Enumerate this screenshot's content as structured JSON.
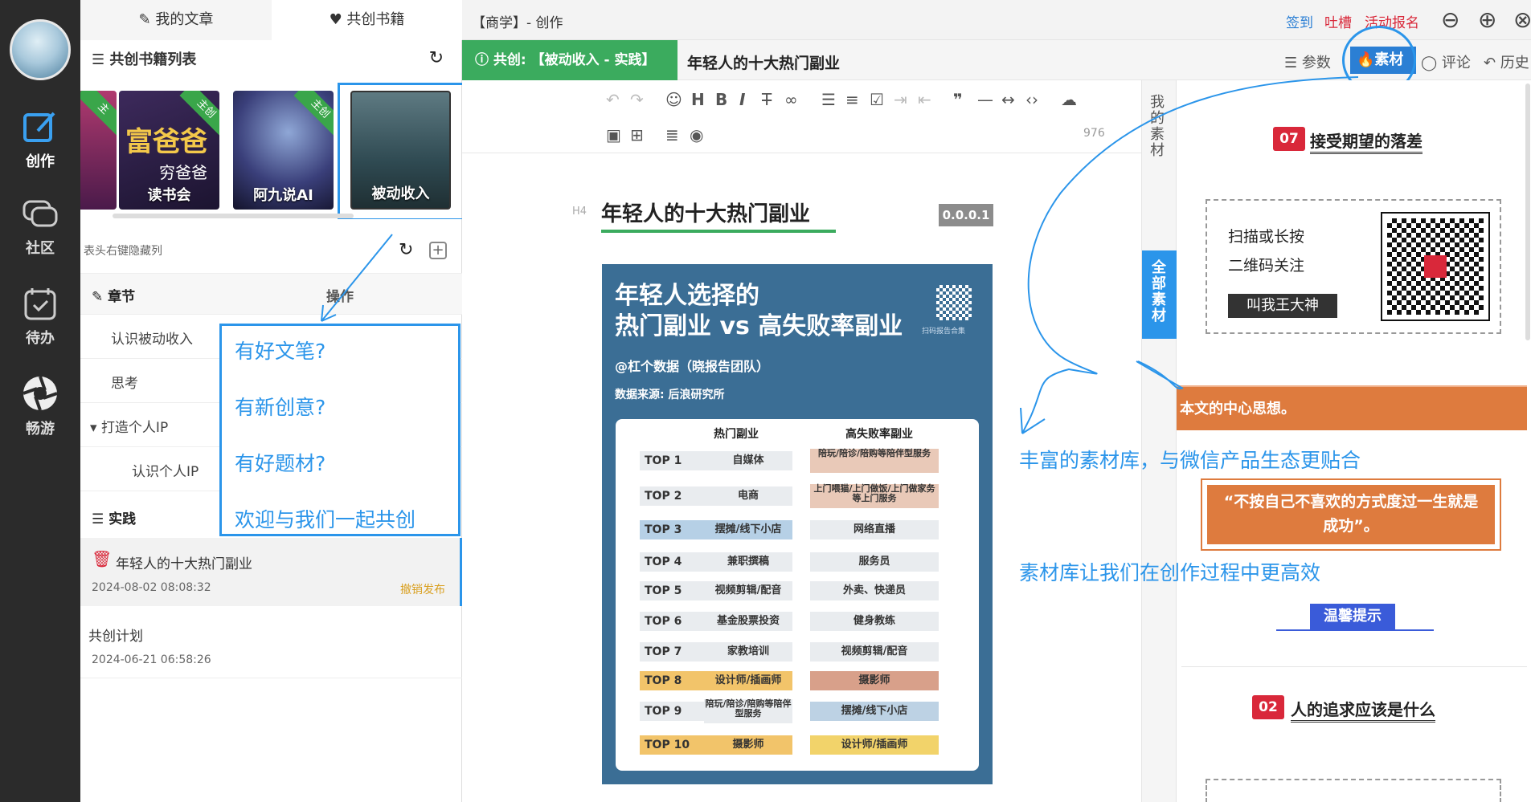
{
  "rail": {
    "items": [
      {
        "label": "创作"
      },
      {
        "label": "社区"
      },
      {
        "label": "待办"
      },
      {
        "label": "畅游"
      }
    ]
  },
  "left_panel": {
    "tabs": [
      "我的文章",
      "共创书籍"
    ],
    "section_title": "共创书籍列表",
    "books": [
      {
        "title": "穷爸爸",
        "subtitle": "读书会",
        "ribbon": "主创",
        "cover_text": "富爸爸"
      },
      {
        "title": "阿九说AI",
        "ribbon": "主创"
      },
      {
        "title": "被动收入"
      }
    ],
    "table_hint": "表头右键隐藏列",
    "columns": [
      "章节",
      "操作"
    ],
    "chapters": [
      "认识被动收入",
      "思考",
      "打造个人IP",
      "认识个人IP"
    ],
    "practice_label": "实践",
    "articles": [
      {
        "title": "年轻人的十大热门副业",
        "date": "2024-08-02 08:08:32",
        "action": "撤销发布"
      },
      {
        "title": "共创计划",
        "date": "2024-06-21 06:58:26"
      }
    ],
    "hints": [
      "有好文笔?",
      "有新创意?",
      "有好题材?",
      "欢迎与我们一起共创"
    ]
  },
  "top_bar": {
    "title": "【商学】- 创作",
    "links": [
      "签到",
      "吐槽",
      "活动报名"
    ]
  },
  "editor": {
    "green_tag": "共创: 【被动收入 - 实践】",
    "doc_title": "年轻人的十大热门副业",
    "char_count": "976",
    "heading_tag": "H4",
    "heading": "年轻人的十大热门副业",
    "version": "0.0.0.1",
    "infographic": {
      "title_line1": "年轻人选择的",
      "title_line2": "热门副业 vs 高失败率副业",
      "author": "@杠个数据（晓报告团队）",
      "source": "数据来源: 后浪研究所",
      "qr_caption": "扫码报告合集",
      "col_left": "热门副业",
      "col_right": "高失败率副业",
      "rows": [
        {
          "rank": "TOP 1",
          "left": "自媒体",
          "right": "陪玩/陪诊/陪购等陪伴型服务"
        },
        {
          "rank": "TOP 2",
          "left": "电商",
          "right": "上门喂猫/上门做饭/上门做家务等上门服务"
        },
        {
          "rank": "TOP 3",
          "left": "摆摊/线下小店",
          "right": "网络直播"
        },
        {
          "rank": "TOP 4",
          "left": "兼职撰稿",
          "right": "服务员"
        },
        {
          "rank": "TOP 5",
          "left": "视频剪辑/配音",
          "right": "外卖、快递员"
        },
        {
          "rank": "TOP 6",
          "left": "基金股票投资",
          "right": "健身教练"
        },
        {
          "rank": "TOP 7",
          "left": "家教培训",
          "right": "视频剪辑/配音"
        },
        {
          "rank": "TOP 8",
          "left": "设计师/插画师",
          "right": "摄影师"
        },
        {
          "rank": "TOP 9",
          "left": "陪玩/陪诊/陪购等陪伴型服务",
          "right": "摆摊/线下小店"
        },
        {
          "rank": "TOP 10",
          "left": "摄影师",
          "right": "设计师/插画师"
        }
      ]
    }
  },
  "right_tabs": [
    "参数",
    "素材",
    "评论",
    "历史"
  ],
  "side_tabs": [
    "我的素材",
    "全部素材"
  ],
  "material": {
    "card1_num": "07",
    "card1_title": "接受期望的落差",
    "qr_line1": "扫描或长按",
    "qr_line2": "二维码关注",
    "qr_button": "叫我王大神",
    "banner": "本文的中心思想。",
    "quote": "“不按自己不喜欢的方式度过一生就是成功”。",
    "tip": "温馨提示",
    "card2_num": "02",
    "card2_title": "人的追求应该是什么"
  },
  "annotations": [
    "丰富的素材库，与微信产品生态更贴合",
    "素材库让我们在创作过程中更高效"
  ],
  "colors": {
    "accent": "#2b95ea",
    "green": "#3bab5e",
    "orange": "#de7b3e",
    "red": "#d9283a"
  }
}
